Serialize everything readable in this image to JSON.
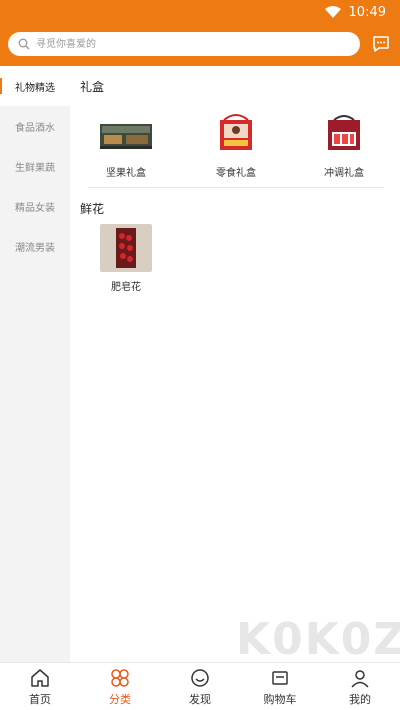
{
  "status_bar": {
    "time": "10:49"
  },
  "search": {
    "placeholder": "寻觅你喜爱的"
  },
  "sidebar": {
    "items": [
      {
        "label": "礼物精选",
        "active": true
      },
      {
        "label": "食品酒水",
        "active": false
      },
      {
        "label": "生鲜果蔬",
        "active": false
      },
      {
        "label": "精品女装",
        "active": false
      },
      {
        "label": "潮流男装",
        "active": false
      }
    ]
  },
  "sections": [
    {
      "title": "礼盒",
      "products": [
        {
          "name": "坚果礼盒"
        },
        {
          "name": "零食礼盒"
        },
        {
          "name": "冲调礼盒"
        }
      ]
    },
    {
      "title": "鲜花",
      "products": [
        {
          "name": "肥皂花"
        }
      ]
    }
  ],
  "tabbar": {
    "tabs": [
      {
        "label": "首页",
        "icon": "home-icon"
      },
      {
        "label": "分类",
        "icon": "category-icon",
        "active": true
      },
      {
        "label": "发现",
        "icon": "discover-icon"
      },
      {
        "label": "购物车",
        "icon": "cart-icon"
      },
      {
        "label": "我的",
        "icon": "profile-icon"
      }
    ]
  },
  "watermark": "K0K0Z",
  "colors": {
    "accent": "#ee7a12",
    "active_tab": "#e85a1b"
  }
}
